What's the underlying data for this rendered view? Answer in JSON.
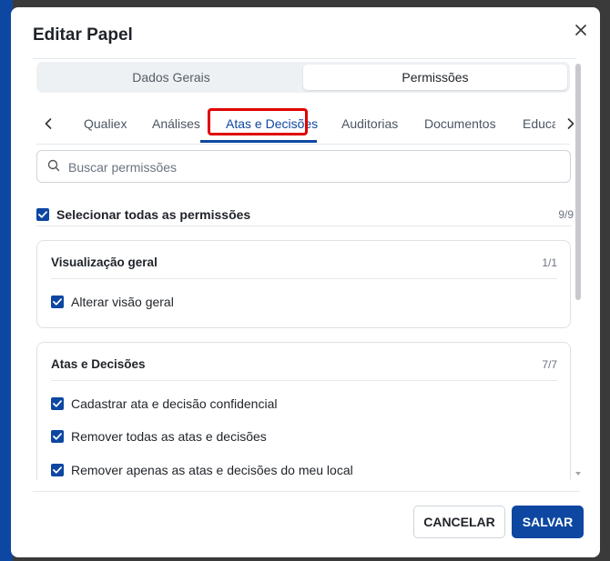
{
  "dialog": {
    "title": "Editar Papel",
    "close_icon": "close-icon"
  },
  "segmented": {
    "left": "Dados Gerais",
    "right": "Permissões",
    "selected": "Permissões"
  },
  "tabs": {
    "items": [
      "Qualiex",
      "Análises",
      "Atas e Decisões",
      "Auditorias",
      "Documentos",
      "Educação"
    ],
    "active": "Atas e Decisões",
    "prev_icon": "chevron-left-icon",
    "next_icon": "chevron-right-icon"
  },
  "search": {
    "placeholder": "Buscar permissões",
    "value": ""
  },
  "select_all": {
    "label": "Selecionar todas as permissões",
    "count": "9/9",
    "checked": true
  },
  "groups": [
    {
      "title": "Visualização geral",
      "count": "1/1",
      "items": [
        "Alterar visão geral"
      ]
    },
    {
      "title": "Atas e Decisões",
      "count": "7/7",
      "items": [
        "Cadastrar ata e decisão confidencial",
        "Remover todas as atas e decisões",
        "Remover apenas as atas e decisões do meu local"
      ]
    }
  ],
  "footer": {
    "cancel": "CANCELAR",
    "save": "SALVAR"
  },
  "colors": {
    "primary": "#0d47a1",
    "highlight": "#e00000"
  }
}
